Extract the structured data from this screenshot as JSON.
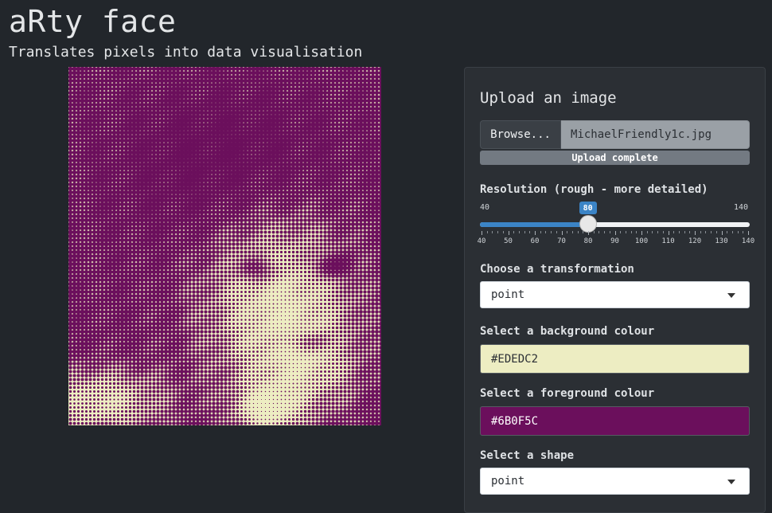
{
  "app": {
    "title": "aRty face",
    "subtitle": "Translates pixels into data visualisation"
  },
  "plot": {
    "background_color": "#EDEDC2",
    "foreground_color": "#6B0F5C"
  },
  "panel": {
    "upload_heading": "Upload an image",
    "browse_label": "Browse...",
    "file_name": "MichaelFriendly1c.jpg",
    "upload_status": "Upload complete",
    "upload_progress": 1.0,
    "resolution": {
      "label": "Resolution (rough - more detailed)",
      "min": 40,
      "max": 140,
      "value": 80,
      "min_label": "40",
      "max_label": "140",
      "value_label": "80",
      "ticks": [
        "40",
        "50",
        "60",
        "70",
        "80",
        "90",
        "100",
        "110",
        "120",
        "130",
        "140"
      ]
    },
    "transformation": {
      "label": "Choose a transformation",
      "selected": "point"
    },
    "background": {
      "label": "Select a background colour",
      "value": "#EDEDC2",
      "color": "#EDEDC2"
    },
    "foreground": {
      "label": "Select a foreground colour",
      "value": "#6B0F5C",
      "color": "#6B0F5C"
    },
    "shape": {
      "label": "Select a shape",
      "selected": "point"
    }
  }
}
